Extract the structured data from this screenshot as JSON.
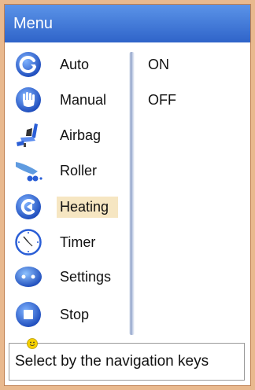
{
  "window": {
    "title": "Menu"
  },
  "menu": {
    "selected": "Heating",
    "items": [
      {
        "label": "Auto",
        "icon": "auto-icon",
        "selected": false
      },
      {
        "label": "Manual",
        "icon": "hand-icon",
        "selected": false
      },
      {
        "label": "Airbag",
        "icon": "massage-chair-icon",
        "selected": false
      },
      {
        "label": "Roller",
        "icon": "roller-icon",
        "selected": false
      },
      {
        "label": "Heating",
        "icon": "heating-icon",
        "selected": true
      },
      {
        "label": "Timer",
        "icon": "clock-icon",
        "selected": false
      },
      {
        "label": "Settings",
        "icon": "settings-icon",
        "selected": false
      },
      {
        "label": "Stop",
        "icon": "stop-icon",
        "selected": false
      }
    ]
  },
  "options": [
    {
      "label": "ON"
    },
    {
      "label": "OFF"
    }
  ],
  "hint": {
    "text": "Select by the navigation keys",
    "icon": "smiley-icon"
  },
  "colors": {
    "title_bar": "#3a72d6",
    "selection_highlight": "#f6e6c2",
    "frame": "#e9b98e",
    "icon_blue": "#1f5fd0"
  }
}
